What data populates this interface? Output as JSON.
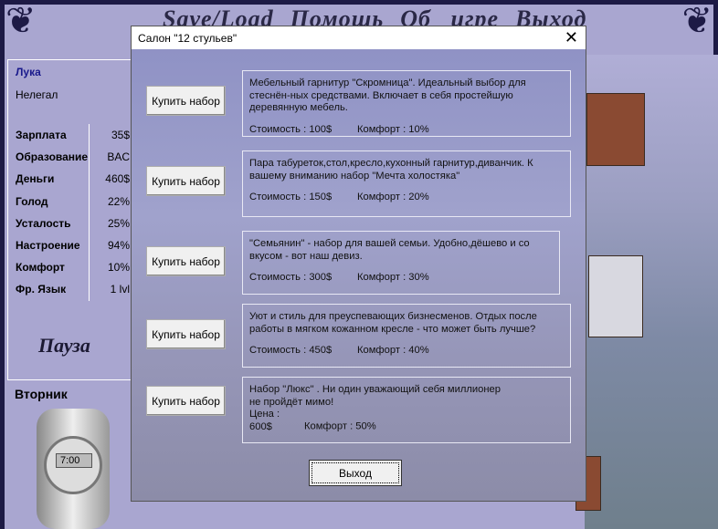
{
  "menu": [
    "Save/Load",
    "Помощь",
    "Об игре",
    "Выход"
  ],
  "player": {
    "name": "Лука",
    "status": "Нелегал"
  },
  "stats": [
    {
      "label": "Зарплата",
      "value": "35$"
    },
    {
      "label": "Образование",
      "value": "BAC"
    },
    {
      "label": "Деньги",
      "value": "460$"
    },
    {
      "label": "Голод",
      "value": "22%"
    },
    {
      "label": "Усталость",
      "value": "25%"
    },
    {
      "label": "Настроение",
      "value": "94%"
    },
    {
      "label": "Комфорт",
      "value": "10%"
    },
    {
      "label": "Фр. Язык",
      "value": "1 lvl"
    }
  ],
  "pause": "Пауза",
  "day": "Вторник",
  "time": "7:00",
  "dialog": {
    "title": "Салон \"12 стульев\"",
    "close": "✕",
    "buy_label": "Купить набор",
    "exit_label": "Выход",
    "items": [
      {
        "desc": "Мебельный гарнитур \"Скромница\". Идеальный выбор для стеснён-ных средствами. Включает в себя простейшую деревянную мебель.",
        "price": "Стоимость : 100$",
        "comfort": "Комфорт : 10%"
      },
      {
        "desc": "Пара табуреток,стол,кресло,кухонный гарнитур,диванчик. К вашему вниманию набор \"Мечта холостяка\"",
        "price": "Стоимость : 150$",
        "comfort": "Комфорт : 20%"
      },
      {
        "desc": "\"Семьянин\" - набор для вашей семьи. Удобно,дёшево и со вкусом - вот наш девиз.",
        "price": "Стоимость : 300$",
        "comfort": "Комфорт : 30%"
      },
      {
        "desc": "Уют и стиль для преуспевающих бизнесменов. Отдых после работы в мягком кожанном кресле - что может быть лучше?",
        "price": "Стоимость : 450$",
        "comfort": "Комфорт : 40%"
      },
      {
        "desc": "Набор \"Люкс\" . Ни один уважающий себя миллионер не пройдёт мимо!",
        "price": "Цена : 600$",
        "comfort": "Комфорт : 50%"
      }
    ]
  }
}
